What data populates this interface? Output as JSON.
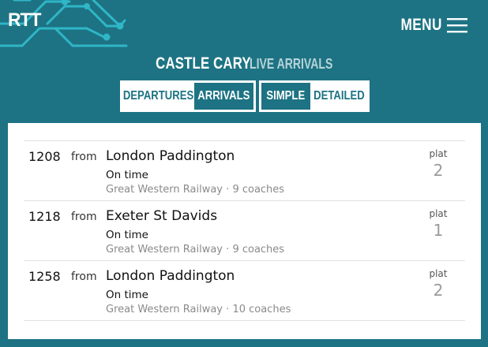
{
  "header": {
    "logo_text": "RTT",
    "menu_label": "MENU",
    "station": "CASTLE CARY",
    "subtitle": "LIVE ARRIVALS"
  },
  "toggles": {
    "direction": [
      {
        "label": "DEPARTURES",
        "active": false
      },
      {
        "label": "ARRIVALS",
        "active": true
      }
    ],
    "view": [
      {
        "label": "SIMPLE",
        "active": true
      },
      {
        "label": "DETAILED",
        "active": false
      }
    ]
  },
  "services": [
    {
      "time": "1208",
      "from_label": "from",
      "origin": "London Paddington",
      "status": "On time",
      "operator": "Great Western Railway",
      "separator": "·",
      "coaches": "9 coaches",
      "plat_label": "plat",
      "platform": "2"
    },
    {
      "time": "1218",
      "from_label": "from",
      "origin": "Exeter St Davids",
      "status": "On time",
      "operator": "Great Western Railway",
      "separator": "·",
      "coaches": "9 coaches",
      "plat_label": "plat",
      "platform": "1"
    },
    {
      "time": "1258",
      "from_label": "from",
      "origin": "London Paddington",
      "status": "On time",
      "operator": "Great Western Railway",
      "separator": "·",
      "coaches": "10 coaches",
      "plat_label": "plat",
      "platform": "2"
    }
  ],
  "colors": {
    "background": "#1d7383",
    "accent_line": "#2fb6c7",
    "panel": "#ffffff",
    "muted_text": "#8a8a8a"
  },
  "icons": {
    "menu": "hamburger-icon",
    "logo_decoration": "rail-network-icon"
  }
}
